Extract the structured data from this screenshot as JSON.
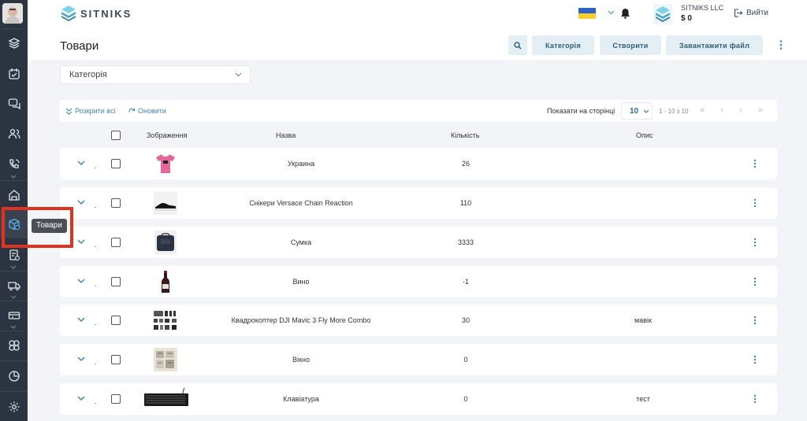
{
  "header": {
    "brand": "SITNIKS",
    "org_name": "SITNIKS LLC",
    "org_balance": "$ 0",
    "logout_label": "Вийти"
  },
  "sidebar": {
    "tooltip": "Товари",
    "items": [
      "layers-icon",
      "calendar-icon",
      "chat-icon",
      "users-icon",
      "phone-icon",
      "warehouse-icon",
      "products-box-icon",
      "orders-icon",
      "delivery-truck-icon",
      "finance-icon",
      "integrations-icon",
      "reports-chart-icon",
      "settings-gear-icon"
    ]
  },
  "page": {
    "title": "Товари",
    "buttons": {
      "category": "Категорія",
      "create": "Створити",
      "upload": "Завантажити файл"
    },
    "category_select": "Категорія"
  },
  "toolbar": {
    "expand_all": "Розкрити всі",
    "refresh": "Оновити",
    "per_page_label": "Показати на сторінці",
    "per_page_value": "10",
    "range": "1 - 10 з 10"
  },
  "table": {
    "columns": {
      "image": "Зображення",
      "name": "Назва",
      "quantity": "Кількість",
      "description": "Опис"
    },
    "rows": [
      {
        "name": "Украина",
        "quantity": "26",
        "description": "",
        "image": "tshirt"
      },
      {
        "name": "Снікери Versace Chain Reaction",
        "quantity": "110",
        "description": "",
        "image": "sneaker"
      },
      {
        "name": "Сумка",
        "quantity": "3333",
        "description": "",
        "image": "bag"
      },
      {
        "name": "Вино",
        "quantity": "-1",
        "description": "",
        "image": "wine"
      },
      {
        "name": "Квадрокоптер DJI Mavic 3 Fly More Combo",
        "quantity": "30",
        "description": "мавік",
        "image": "drone-kit"
      },
      {
        "name": "Вікно",
        "quantity": "0",
        "description": "",
        "image": "window"
      },
      {
        "name": "Клавіатура",
        "quantity": "0",
        "description": "тест",
        "image": "keyboard"
      }
    ]
  },
  "colors": {
    "sidebar_bg": "#2c3341",
    "accent": "#3f86b5",
    "button_bg": "#e3eef5",
    "highlight": "#e0321f"
  }
}
